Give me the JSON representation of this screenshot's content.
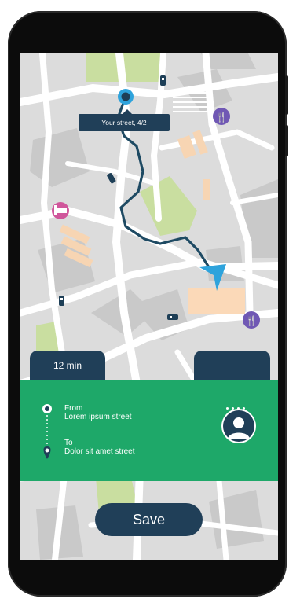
{
  "map": {
    "location_label": "Your street, 4/2",
    "icons": [
      "location-pin-icon",
      "restaurant-icon",
      "hotel-icon",
      "navigation-arrow-icon",
      "car-icon"
    ]
  },
  "eta_tab": {
    "label": "12 min"
  },
  "trip": {
    "from_heading": "From",
    "from_address": "Lorem ipsum street",
    "to_heading": "To",
    "to_address": "Dolor sit amet street",
    "driver_icon": "user-avatar-icon",
    "more_icon": "more-dots-icon"
  },
  "actions": {
    "save_label": "Save"
  },
  "colors": {
    "map_background": "#dcdcdc",
    "roads": "#ffffff",
    "park": "#c9dea0",
    "buildings": "#c9c9c9",
    "highlight_block": "#fbd9b8",
    "route_line": "#1e4a63",
    "accent_blue": "#2ea3dc",
    "panel_green": "#1ea869",
    "dark_navy": "#203f58",
    "poi_purple": "#7058b4",
    "poi_pink": "#d0569b"
  }
}
